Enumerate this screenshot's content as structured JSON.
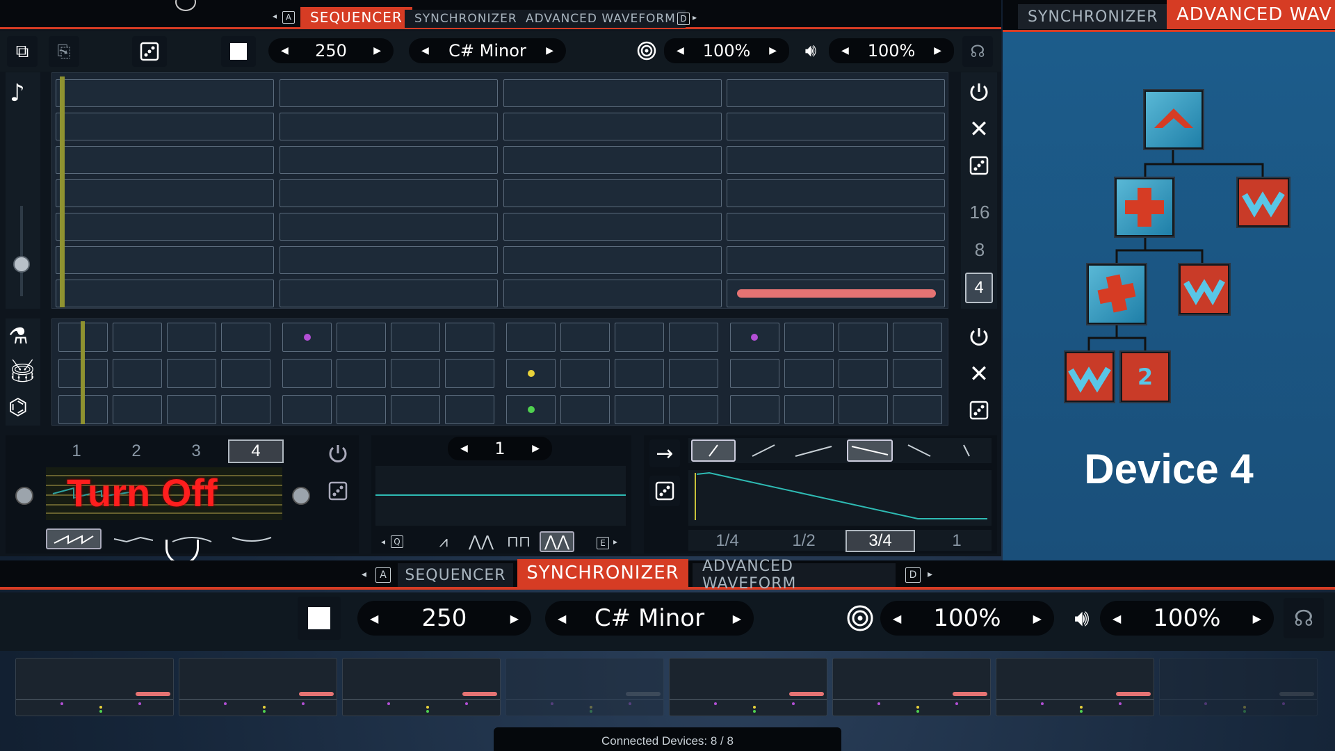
{
  "top": {
    "tabs": [
      {
        "label": "SEQUENCER",
        "active": true
      },
      {
        "label": "SYNCHRONIZER",
        "active": false
      },
      {
        "label": "ADVANCED WAVEFORM",
        "active": false
      }
    ],
    "key_left": "A",
    "key_right": "D",
    "tempo": "250",
    "scale": "C# Minor",
    "target_pct": "100%",
    "volume_pct": "100%"
  },
  "right": {
    "tabs": [
      "SYNCHRONIZER",
      "ADVANCED WAV"
    ],
    "device_label": "Device 4"
  },
  "side_numbers": [
    "16",
    "8",
    "4"
  ],
  "step_divisions": [
    "1",
    "2",
    "3",
    "4"
  ],
  "overlay_text": "Turn Off",
  "lfo": {
    "value": "1",
    "key_q": "Q",
    "key_e": "E"
  },
  "env": {
    "fractions": [
      "1/4",
      "1/2",
      "3/4",
      "1"
    ],
    "selected_fraction": "3/4"
  },
  "bottom": {
    "tabs": [
      {
        "label": "SEQUENCER",
        "active": false
      },
      {
        "label": "SYNCHRONIZER",
        "active": true
      },
      {
        "label": "ADVANCED WAVEFORM",
        "active": false
      }
    ],
    "key_left": "A",
    "key_right": "D",
    "tempo": "250",
    "scale": "C# Minor",
    "target_pct": "100%",
    "volume_pct": "100%"
  },
  "status": "Connected Devices: 8 / 8",
  "colors": {
    "accent": "#d63c24",
    "note_bar": "#e57373",
    "purple": "#b44fd6",
    "yellow": "#e8d23a",
    "green": "#4fd14f",
    "playhead": "#a8a63a"
  }
}
